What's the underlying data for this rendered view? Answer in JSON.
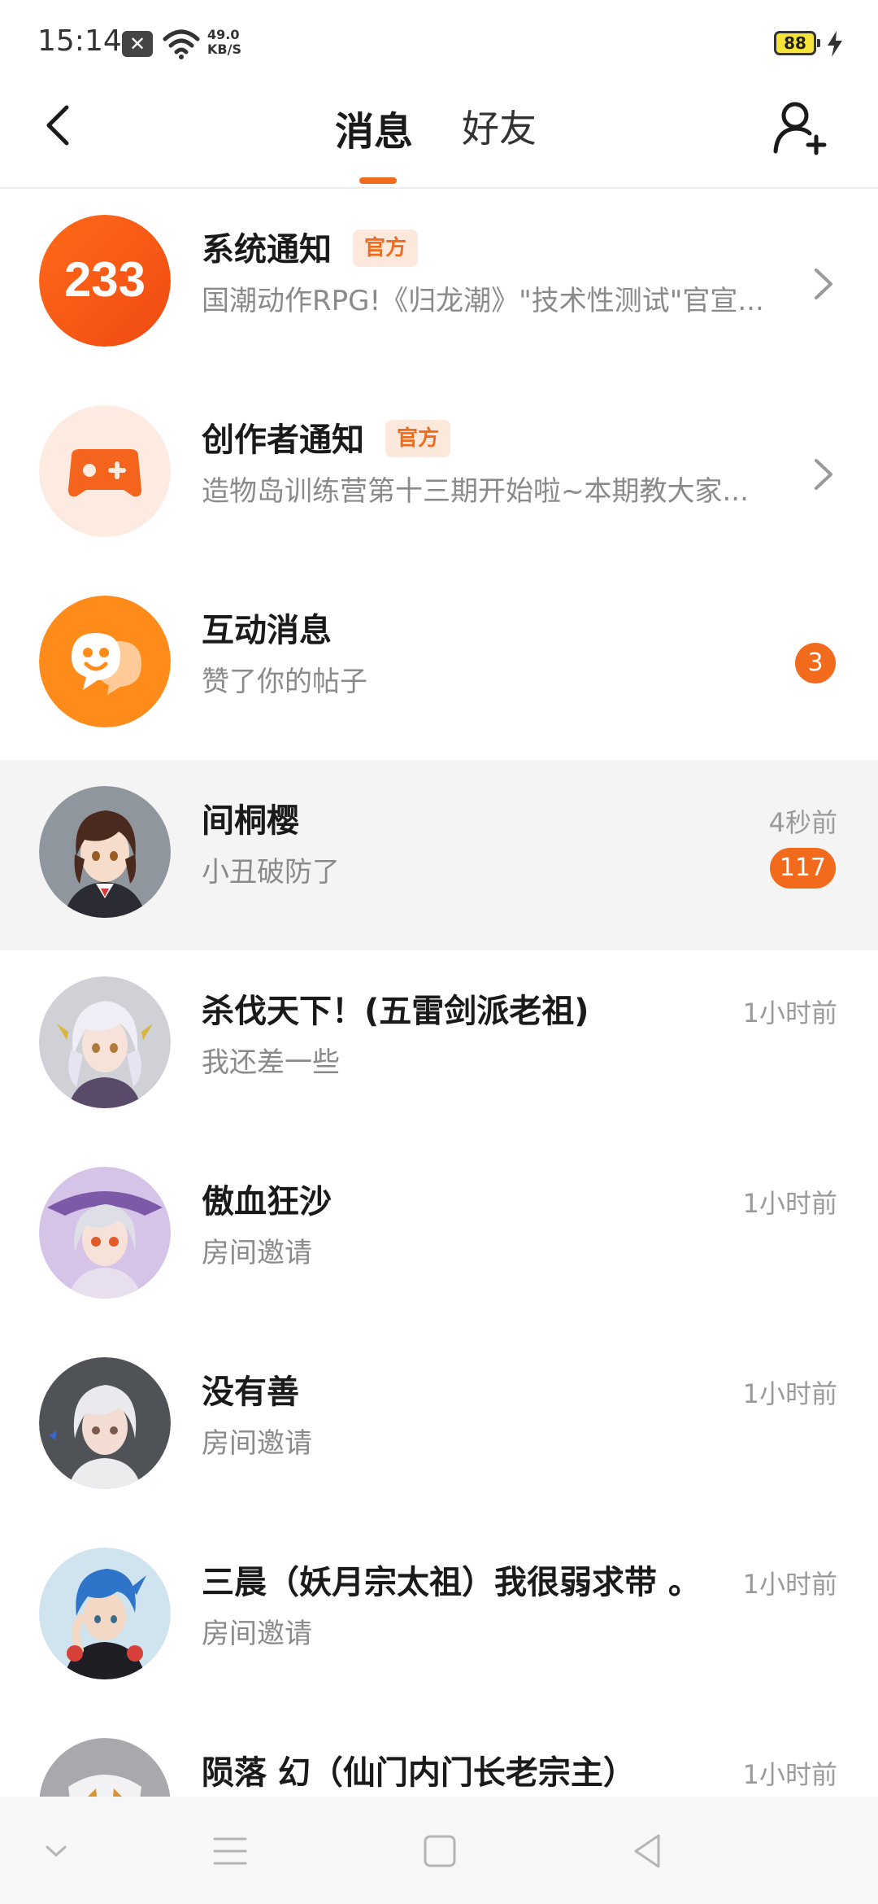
{
  "status_bar": {
    "time": "15:14",
    "notification_icon": "close-box-icon",
    "net_speed_value": "49.0",
    "net_speed_unit": "KB/S",
    "battery": "88"
  },
  "header": {
    "tabs": [
      {
        "label": "消息",
        "active": true
      },
      {
        "label": "好友",
        "active": false
      }
    ],
    "accent_color": "#f26b1d"
  },
  "messages": [
    {
      "title": "系统通知",
      "badge": "官方",
      "subtitle": "国潮动作RPG!《归龙潮》\"技术性测试\"官宣...",
      "avatar": "233-logo",
      "has_chevron": true
    },
    {
      "title": "创作者通知",
      "badge": "官方",
      "subtitle": "造物岛训练营第十三期开始啦~本期教大家...",
      "avatar": "gamepad-icon",
      "has_chevron": true
    },
    {
      "title": "互动消息",
      "subtitle": "赞了你的帖子",
      "avatar": "chat-smile-icon",
      "count": "3"
    },
    {
      "title": "间桐樱",
      "subtitle": "小丑破防了",
      "time": "4秒前",
      "count": "117",
      "highlight": true
    },
    {
      "title": "杀伐天下！(五雷剑派老祖)",
      "subtitle": "我还差一些",
      "time": "1小时前"
    },
    {
      "title": "傲血狂沙",
      "subtitle": "房间邀请",
      "time": "1小时前"
    },
    {
      "title": "没有善",
      "subtitle": "房间邀请",
      "time": "1小时前"
    },
    {
      "title": "三晨（妖月宗太祖）我很弱求带 。",
      "subtitle": "房间邀请",
      "time": "1小时前"
    },
    {
      "title": "陨落  幻（仙门内门长老宗主）",
      "subtitle": "",
      "time": "1小时前"
    }
  ],
  "logo_text": "233"
}
